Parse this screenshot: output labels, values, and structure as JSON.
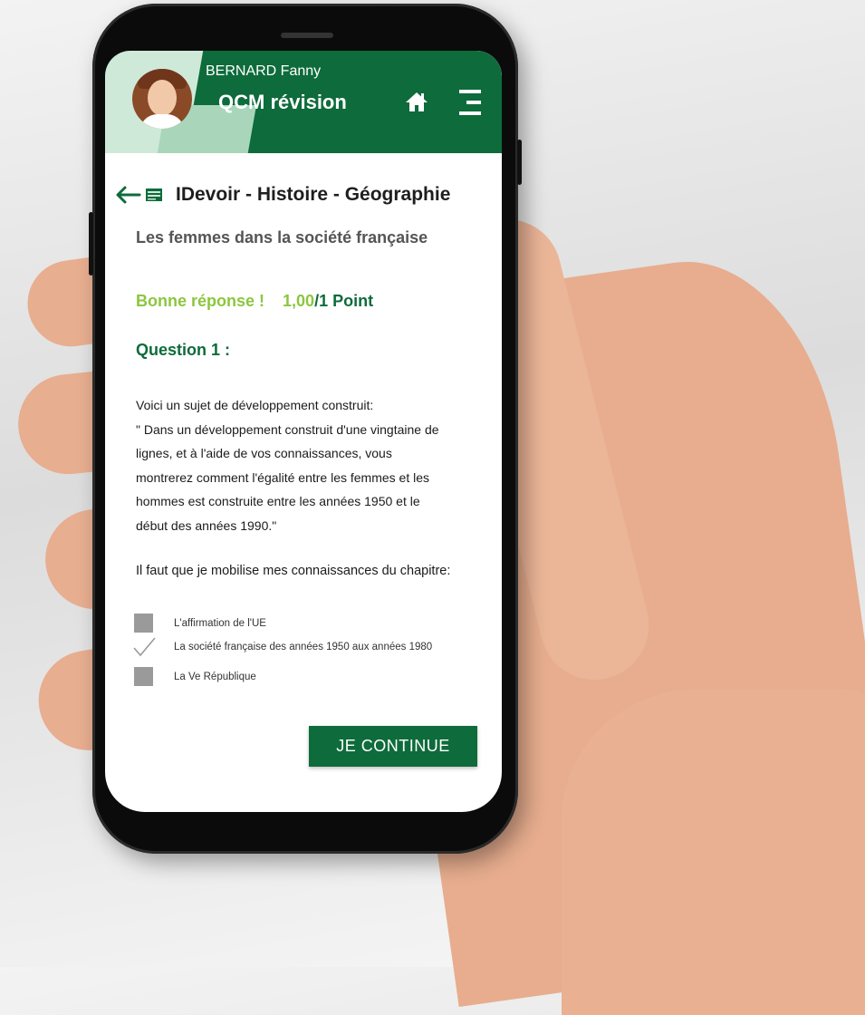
{
  "header": {
    "user_name": "BERNARD Fanny",
    "app_title": "QCM révision",
    "home_icon": "home-icon",
    "menu_icon": "menu-icon"
  },
  "nav": {
    "back_icon": "arrow-left-icon",
    "doc_icon": "document-icon",
    "title": "IDevoir - Histoire - Géographie"
  },
  "subject": "Les femmes dans la société française",
  "result": {
    "status": "Bonne réponse !",
    "score_value": "1,00",
    "score_total": "/1 Point"
  },
  "question": {
    "title": "Question 1 :",
    "lines": [
      "Voici un sujet de développement construit:",
      "\" Dans un développement construit d'une vingtaine de",
      "lignes, et à l'aide de vos connaissances, vous",
      "montrerez comment l'égalité entre les femmes et les",
      "hommes est construite entre les années 1950 et le",
      "début des années 1990.\""
    ],
    "prompt": "Il faut que je mobilise mes connaissances du chapitre:"
  },
  "options": [
    {
      "label": "L'affirmation de l'UE",
      "checked": false
    },
    {
      "label": "La société française des années 1950 aux années 1980",
      "checked": true
    },
    {
      "label": "La Ve République",
      "checked": false
    }
  ],
  "continue_label": "JE CONTINUE",
  "colors": {
    "primary_green": "#0e6b3b",
    "light_green": "#8cc63f",
    "header_light": "#cfe9d9"
  }
}
